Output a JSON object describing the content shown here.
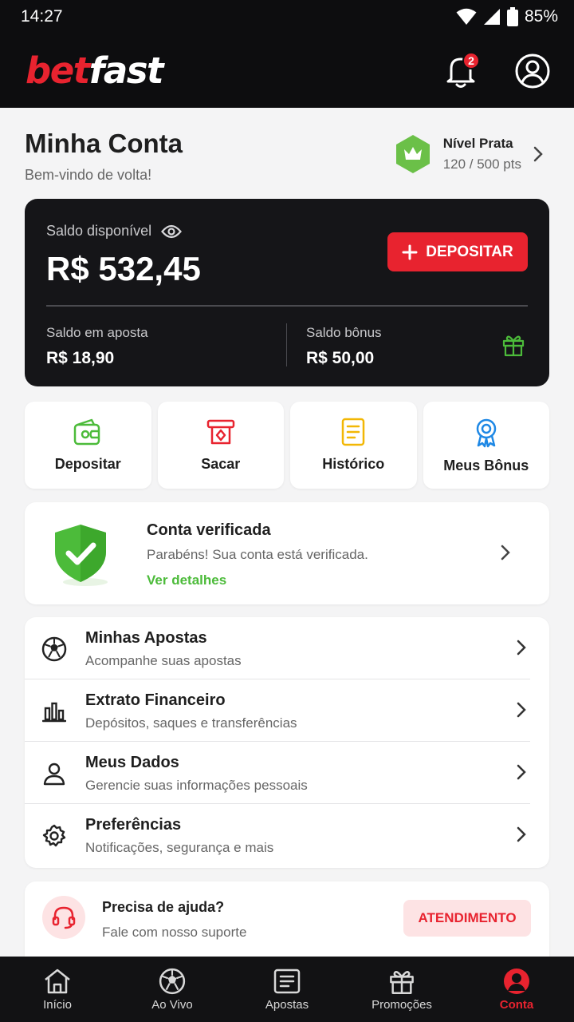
{
  "status_bar": {
    "time": "14:27",
    "battery": "85%"
  },
  "header": {
    "logo_part1": "bet",
    "logo_part2": "fast",
    "notification_count": "2"
  },
  "account": {
    "title": "Minha Conta",
    "welcome": "Bem-vindo de volta!",
    "level_name": "Nível Prata",
    "level_points": "120 / 500 pts"
  },
  "balance": {
    "label": "Saldo disponível",
    "amount": "R$ 532,45",
    "deposit_label": "DEPOSITAR",
    "bet_label": "Saldo em aposta",
    "bet_value": "R$ 18,90",
    "bonus_label": "Saldo bônus",
    "bonus_value": "R$ 50,00"
  },
  "quick_actions": [
    {
      "label": "Depositar",
      "icon": "wallet-icon"
    },
    {
      "label": "Sacar",
      "icon": "withdraw-icon"
    },
    {
      "label": "Histórico",
      "icon": "document-icon"
    },
    {
      "label": "Meus Bônus",
      "icon": "award-icon"
    }
  ],
  "verification": {
    "title": "Conta verificada",
    "description": "Parabéns! Sua conta está verificada.",
    "link": "Ver detalhes"
  },
  "menu": [
    {
      "title": "Minhas Apostas",
      "subtitle": "Acompanhe suas apostas",
      "icon": "soccer-ball-icon"
    },
    {
      "title": "Extrato Financeiro",
      "subtitle": "Depósitos, saques e transferências",
      "icon": "chart-icon"
    },
    {
      "title": "Meus Dados",
      "subtitle": "Gerencie suas informações pessoais",
      "icon": "user-icon"
    },
    {
      "title": "Preferências",
      "subtitle": "Notificações, segurança e mais",
      "icon": "gear-icon"
    }
  ],
  "help": {
    "title": "Precisa de ajuda?",
    "subtitle": "Fale com nosso suporte",
    "button": "ATENDIMENTO"
  },
  "bottom_nav": [
    {
      "label": "Início",
      "icon": "home-icon"
    },
    {
      "label": "Ao Vivo",
      "icon": "soccer-ball-icon"
    },
    {
      "label": "Apostas",
      "icon": "ticket-icon"
    },
    {
      "label": "Promoções",
      "icon": "gift-icon"
    },
    {
      "label": "Conta",
      "icon": "account-icon",
      "active": true
    }
  ],
  "colors": {
    "brand_red": "#e8232f",
    "success_green": "#4cbb3a",
    "dark": "#151518"
  }
}
